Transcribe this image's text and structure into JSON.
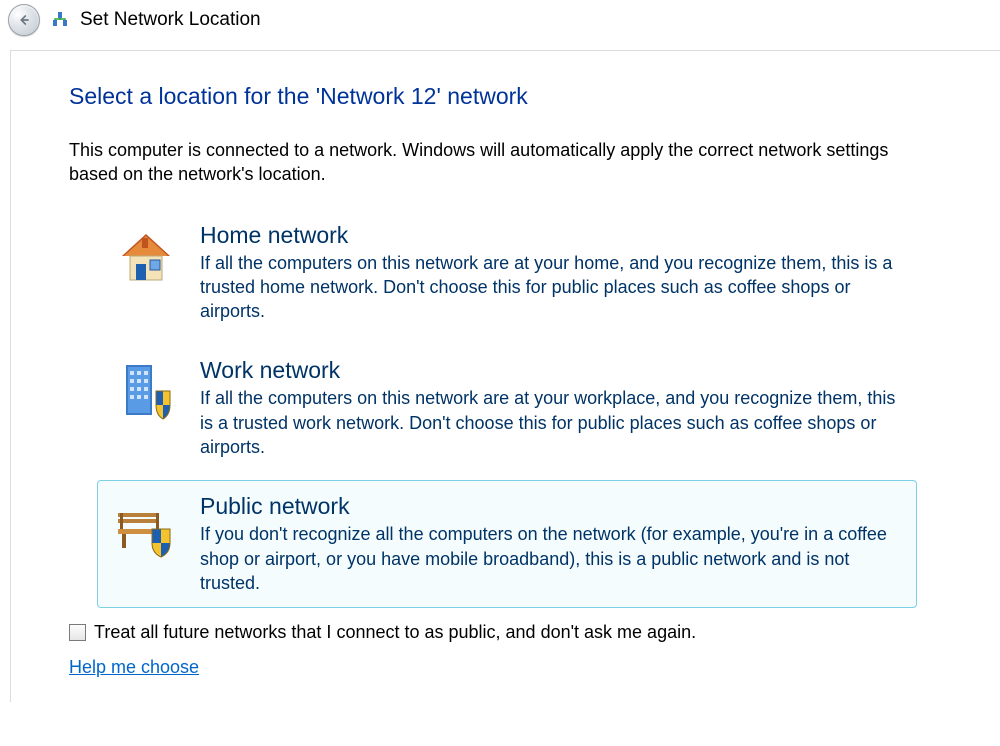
{
  "titlebar": {
    "title": "Set Network Location",
    "icon_name": "network-location-icon"
  },
  "heading": "Select a location for the 'Network  12' network",
  "intro": "This computer is connected to a network. Windows will automatically apply the correct network settings based on the network's location.",
  "options": [
    {
      "id": "home",
      "title": "Home network",
      "desc": "If all the computers on this network are at your home, and you recognize them, this is a trusted home network.  Don't choose this for public places such as coffee shops or airports.",
      "icon": "house-icon",
      "selected": false
    },
    {
      "id": "work",
      "title": "Work network",
      "desc": "If all the computers on this network are at your workplace, and you recognize them, this is a trusted work network.  Don't choose this for public places such as coffee shops or airports.",
      "icon": "office-shield-icon",
      "selected": false
    },
    {
      "id": "public",
      "title": "Public network",
      "desc": "If you don't recognize all the computers on the network (for example, you're in a coffee shop or airport, or you have mobile broadband), this is a public network and is not trusted.",
      "icon": "bench-shield-icon",
      "selected": true
    }
  ],
  "checkbox_label": "Treat all future networks that I connect to as public, and don't ask me again.",
  "checkbox_checked": false,
  "help_link": "Help me choose"
}
